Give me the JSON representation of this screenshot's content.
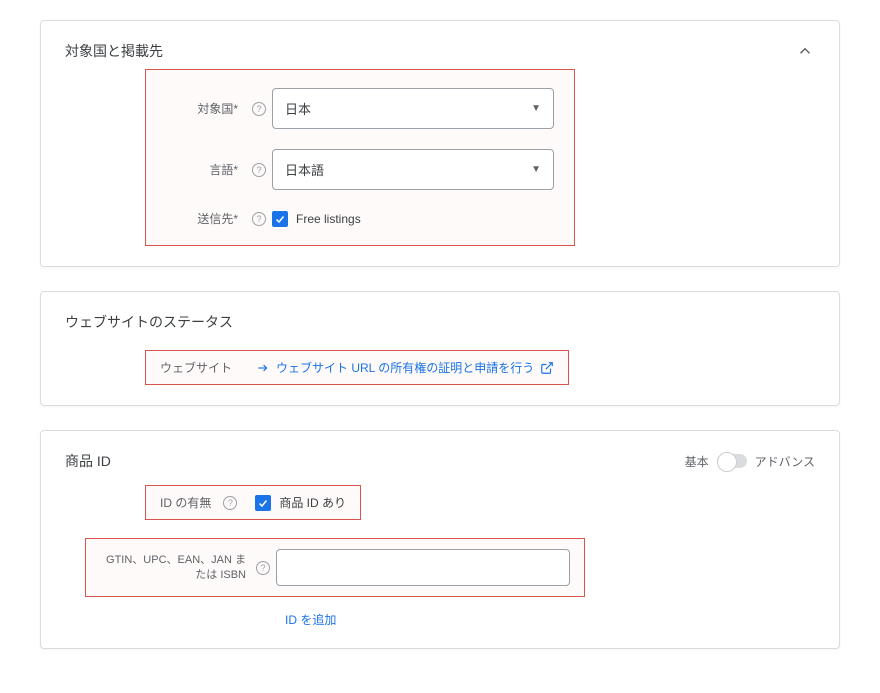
{
  "targeting": {
    "title": "対象国と掲載先",
    "country_label": "対象国*",
    "country_value": "日本",
    "language_label": "言語*",
    "language_value": "日本語",
    "destination_label": "送信先*",
    "destination_checkbox_label": "Free listings"
  },
  "website": {
    "title": "ウェブサイトのステータス",
    "label": "ウェブサイト",
    "link_text": "ウェブサイト URL の所有権の証明と申請を行う"
  },
  "product": {
    "title": "商品 ID",
    "toggle_basic": "基本",
    "toggle_advanced": "アドバンス",
    "id_presence_label": "ID の有無",
    "id_presence_checkbox_label": "商品 ID あり",
    "gtin_label": "GTIN、UPC、EAN、JAN または ISBN",
    "gtin_value": "",
    "add_id_link": "ID を追加"
  }
}
